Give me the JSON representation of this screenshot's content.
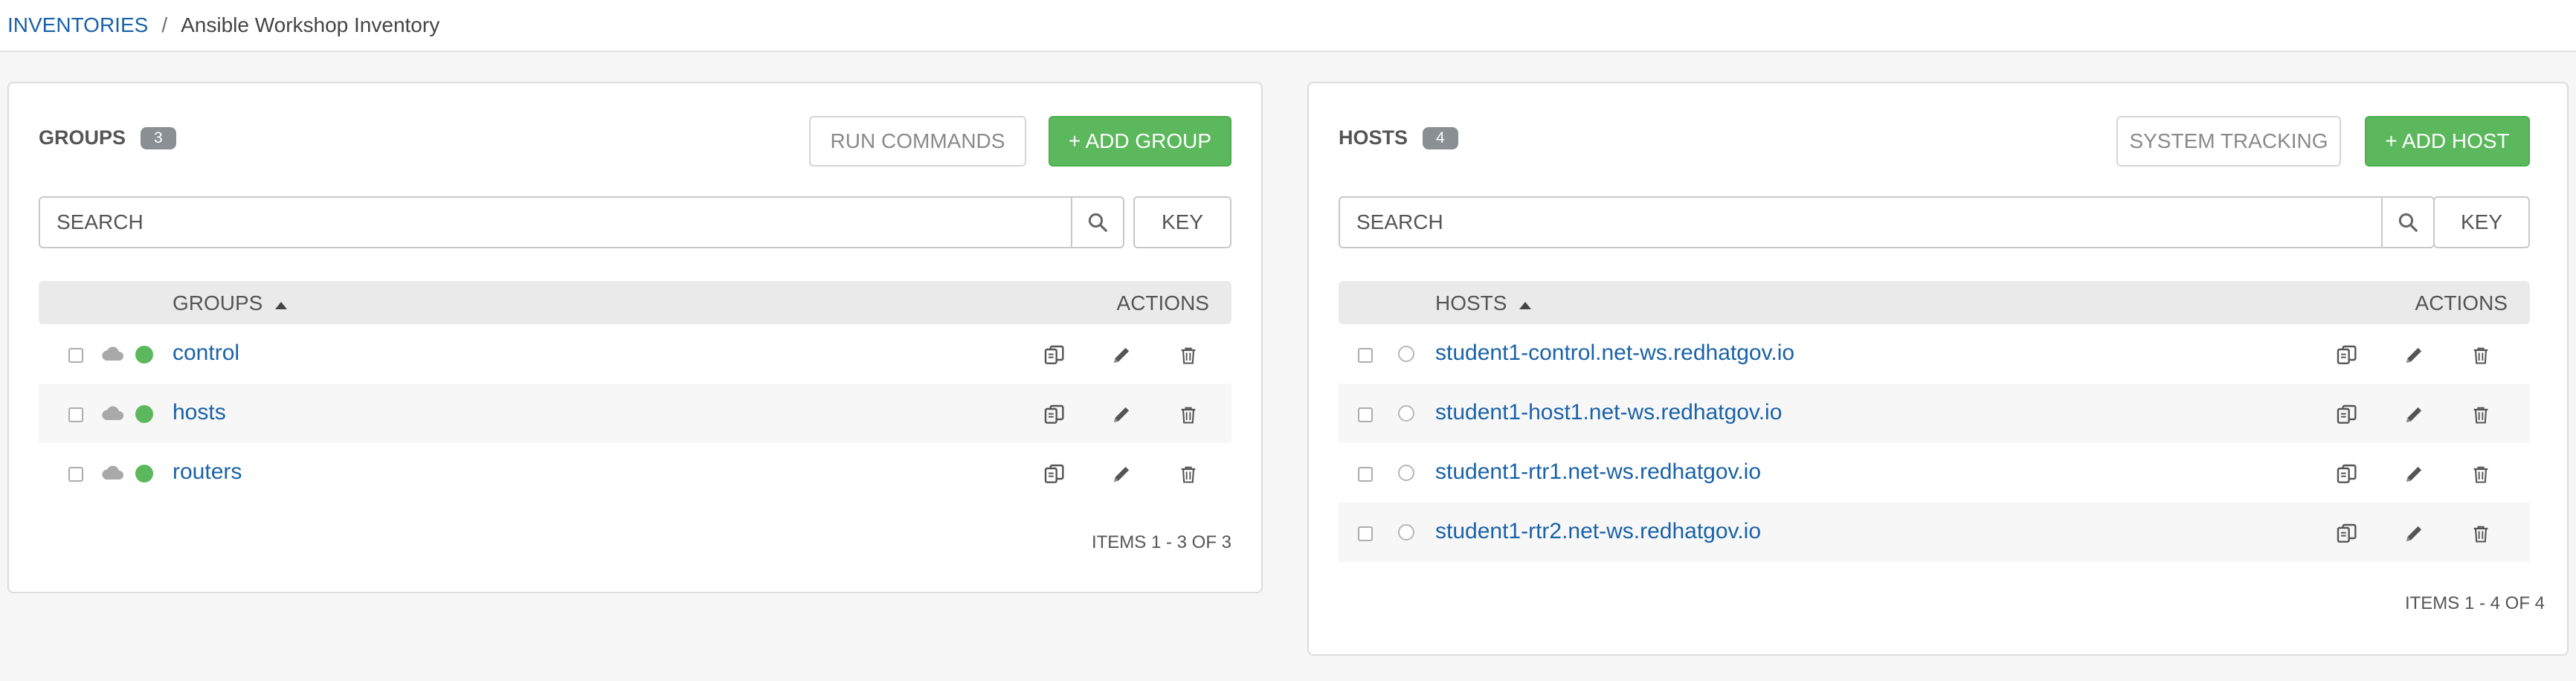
{
  "breadcrumb": {
    "parent": "INVENTORIES",
    "separator": "/",
    "current": "Ansible Workshop Inventory"
  },
  "groups_panel": {
    "title": "GROUPS",
    "count": "3",
    "run_commands_label": "RUN COMMANDS",
    "add_label": "+ ADD GROUP",
    "search_placeholder": "SEARCH",
    "key_label": "KEY",
    "column_name": "GROUPS",
    "column_actions": "ACTIONS",
    "rows": [
      {
        "name": "control"
      },
      {
        "name": "hosts"
      },
      {
        "name": "routers"
      }
    ],
    "footer": "ITEMS  1 - 3 OF 3"
  },
  "hosts_panel": {
    "title": "HOSTS",
    "count": "4",
    "system_tracking_label": "SYSTEM TRACKING",
    "add_label": "+ ADD HOST",
    "search_placeholder": "SEARCH",
    "key_label": "KEY",
    "column_name": "HOSTS",
    "column_actions": "ACTIONS",
    "rows": [
      {
        "name": "student1-control.net-ws.redhatgov.io"
      },
      {
        "name": "student1-host1.net-ws.redhatgov.io"
      },
      {
        "name": "student1-rtr1.net-ws.redhatgov.io"
      },
      {
        "name": "student1-rtr2.net-ws.redhatgov.io"
      }
    ],
    "footer": "ITEMS  1 - 4 OF 4"
  },
  "colors": {
    "link": "#1a62a8",
    "success": "#5cb85c",
    "badge": "#8a8f93",
    "header_bg": "#eaeaea"
  },
  "icons": {
    "search": "search-icon",
    "sort": "sort-ascending-icon",
    "cloud": "cloud-icon",
    "copy": "copy-icon",
    "edit": "pencil-icon",
    "delete": "trash-icon"
  }
}
